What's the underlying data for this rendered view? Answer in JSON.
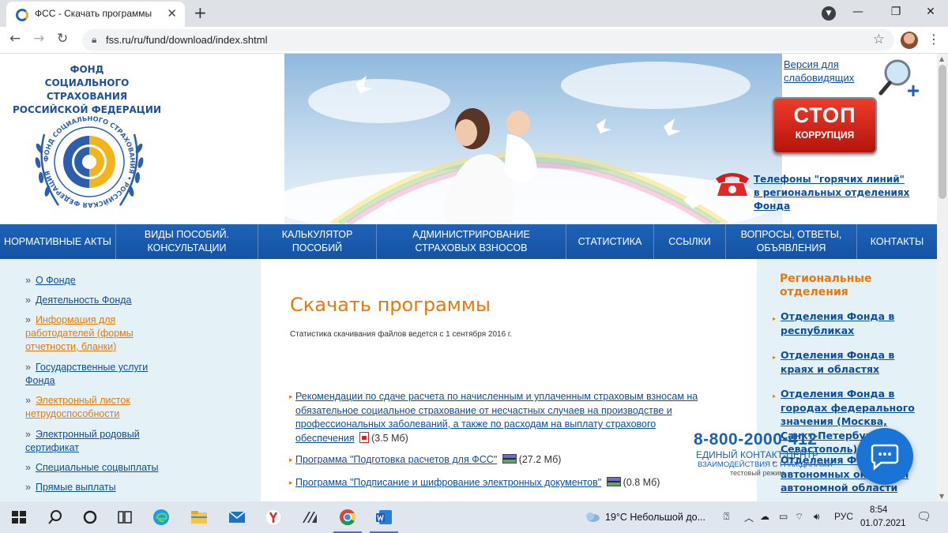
{
  "browser": {
    "tab_title": "ФСС - Скачать программы",
    "url": "fss.ru/ru/fund/download/index.shtml"
  },
  "header": {
    "fund_name": [
      "ФОНД",
      "СОЦИАЛЬНОГО СТРАХОВАНИЯ",
      "РОССИЙСКОЙ ФЕДЕРАЦИИ"
    ],
    "logo_ring_text": "ФОНД СОЦИАЛЬНОГО СТРАХОВАНИЯ • РОССИЙСКАЯ ФЕДЕРАЦИЯ",
    "poor_vision_link": "Версия для слабовидящих",
    "stop_big": "СТОП",
    "stop_small": "КОРРУПЦИЯ",
    "hotlines_link": "Телефоны \"горячих линий\" в региональных отделениях Фонда"
  },
  "nav": {
    "items": [
      {
        "label": "НОРМАТИВНЫЕ АКТЫ"
      },
      {
        "label": "ВИДЫ ПОСОБИЙ. КОНСУЛЬТАЦИИ"
      },
      {
        "label": "КАЛЬКУЛЯТОР ПОСОБИЙ"
      },
      {
        "label": "АДМИНИСТРИРОВАНИЕ СТРАХОВЫХ ВЗНОСОВ"
      },
      {
        "label": "СТАТИСТИКА"
      },
      {
        "label": "ССЫЛКИ"
      },
      {
        "label": "ВОПРОСЫ, ОТВЕТЫ, ОБЪЯВЛЕНИЯ"
      },
      {
        "label": "КОНТАКТЫ"
      }
    ]
  },
  "sidebar": {
    "bullet": "»",
    "items": [
      {
        "label": "О Фонде",
        "color": "#0b4ea2"
      },
      {
        "label": "Деятельность Фонда",
        "color": "#0b4ea2"
      },
      {
        "label": "Информация для работодателей (формы отчетности, бланки)",
        "color": "#e8780b"
      },
      {
        "label": "Государственные услуги Фонда",
        "color": "#0b4ea2"
      },
      {
        "label": "Электронный листок нетрудоспособности",
        "color": "#e8780b"
      },
      {
        "label": "Электронный родовый сертификат",
        "color": "#0b4ea2"
      },
      {
        "label": "Специальные соцвыплаты",
        "color": "#0b4ea2"
      },
      {
        "label": "Прямые выплаты",
        "color": "#0b4ea2"
      }
    ]
  },
  "content": {
    "title": "Скачать программы",
    "note": "Статистика скачивания файлов ведется с 1 сентября 2016 г.",
    "docs": [
      {
        "title": "Рекомендации по сдаче расчета по начисленным и уплаченным страховым взносам на обязательное социальное страхование от несчастных случаев на производстве и профессиональных заболеваний, а также по расходам на выплату страхового обеспечения",
        "icon": "pdf-icon",
        "size": "(3.5 Мб)"
      },
      {
        "title": "Программа \"Подготовка расчетов для ФСС\"",
        "icon": "exe-icon",
        "size": "(27.2 Мб)"
      },
      {
        "title": "Программа \"Подписание и шифрование электронных документов\"",
        "icon": "exe-icon",
        "size": "(0.8 Мб)"
      }
    ]
  },
  "regions": {
    "title": "Региональные отделения",
    "items": [
      {
        "label": "Отделения Фонда в республиках"
      },
      {
        "label": "Отделения Фонда в краях и областях"
      },
      {
        "label": "Отделения Фонда в городах федерального значения (Москва, Санкт-Петербург, Севастополь)"
      },
      {
        "label": "Отделения Фонда в автономных округах и автономной области"
      }
    ]
  },
  "hotline": {
    "number": "8-800-2000-412",
    "line1": "ЕДИНЫЙ КОНТАКТ-ЦЕНТР",
    "line2": "ВЗАИМОДЕЙСТВИЯ С ГРАЖДАНАМИ",
    "line3": "тестовый режим"
  },
  "taskbar": {
    "weather": "19°C  Небольшой до...",
    "language": "РУС",
    "time": "8:54",
    "date": "01.07.2021"
  }
}
